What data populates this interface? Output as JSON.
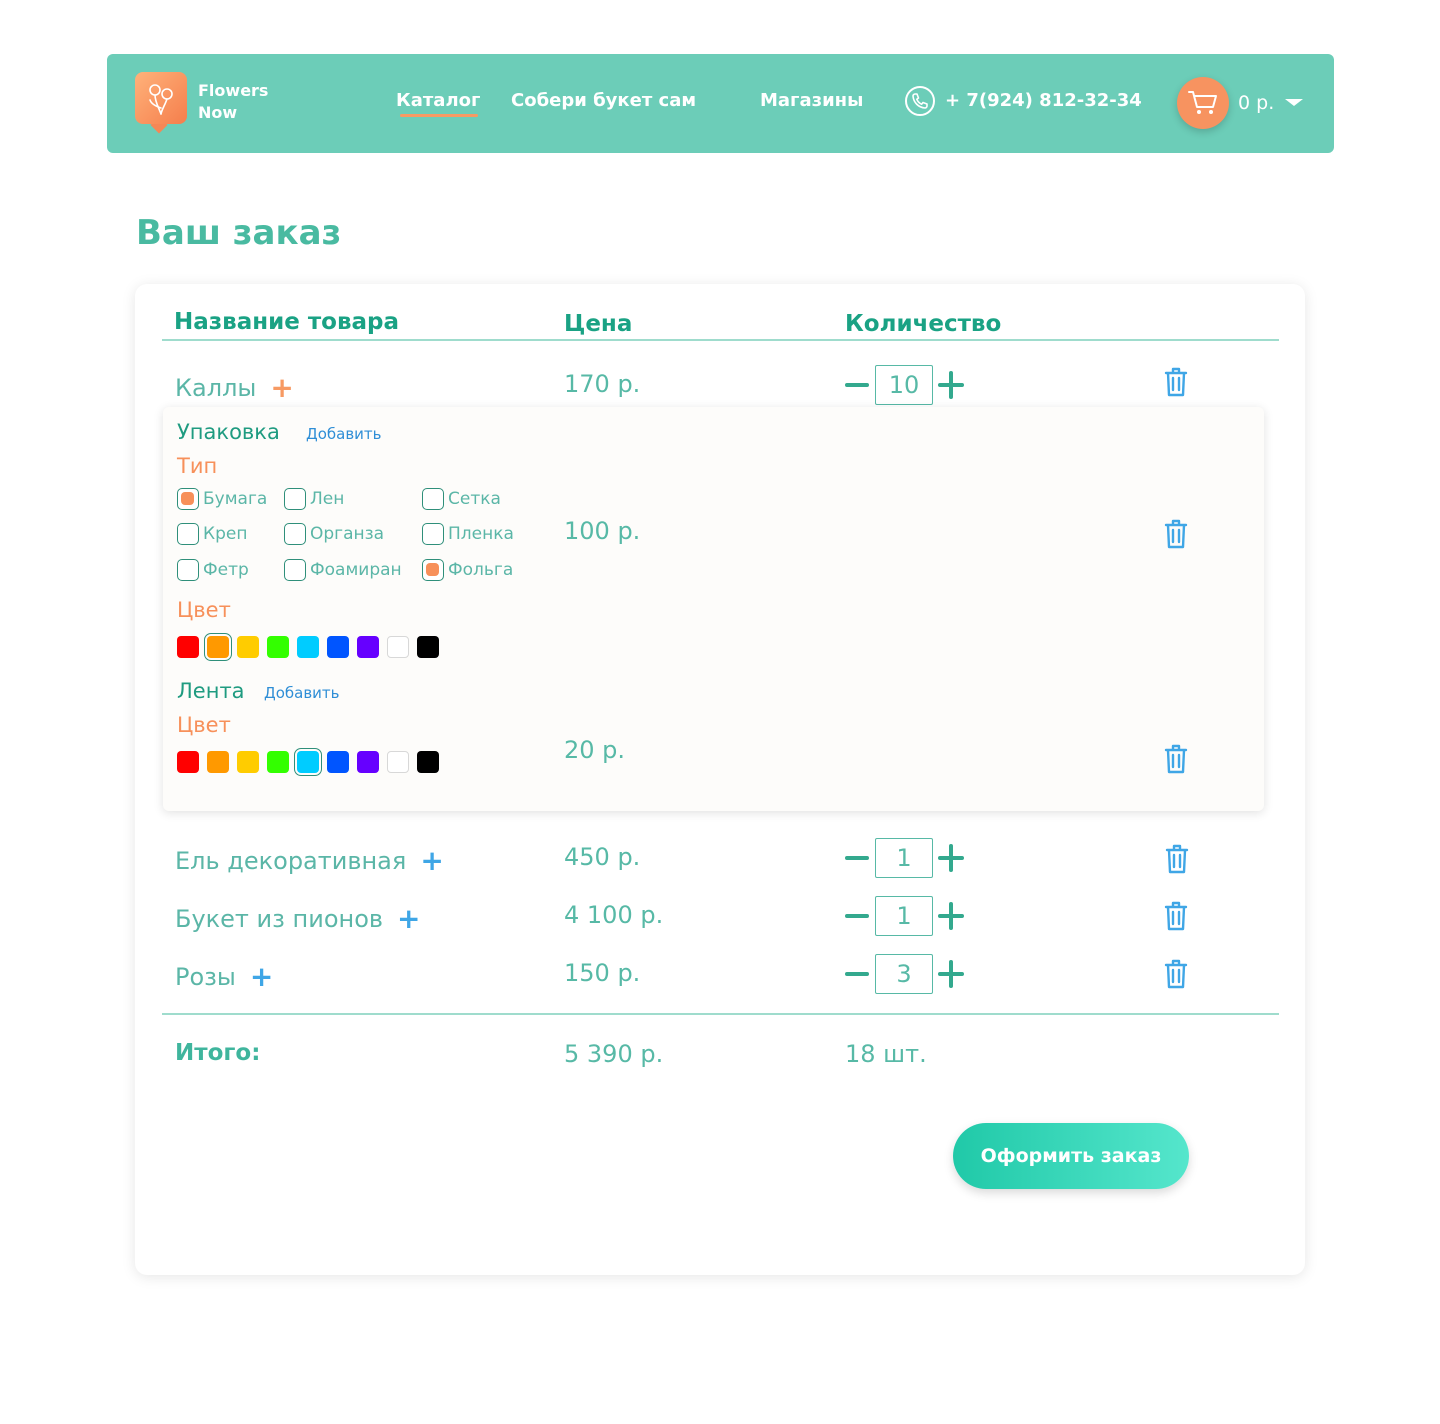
{
  "header": {
    "brand_line1": "Flowers",
    "brand_line2": "Now",
    "nav": [
      "Каталог",
      "Собери букет сам",
      "Магазины"
    ],
    "phone": "+ 7(924) 812-32-34",
    "cart_sum": "0 р.",
    "colors": {
      "bar": "#6ccdb8",
      "accent": "#f79360"
    }
  },
  "page_title": "Ваш заказ",
  "table": {
    "headers": {
      "name": "Название товара",
      "price": "Цена",
      "qty": "Количество"
    },
    "rows": [
      {
        "name": "Каллы",
        "price": "170 р.",
        "qty": "10"
      },
      {
        "name": "Ель декоративная",
        "price": "450 р.",
        "qty": "1"
      },
      {
        "name": "Букет из пионов",
        "price": "4 100 р.",
        "qty": "1"
      },
      {
        "name": "Розы",
        "price": "150 р.",
        "qty": "3"
      }
    ]
  },
  "options": {
    "packaging": {
      "title": "Упаковка",
      "add": "Добавить",
      "type_title": "Тип",
      "types": [
        {
          "label": "Бумага",
          "checked": true
        },
        {
          "label": "Лен",
          "checked": false
        },
        {
          "label": "Сетка",
          "checked": false
        },
        {
          "label": "Креп",
          "checked": false
        },
        {
          "label": "Органза",
          "checked": false
        },
        {
          "label": "Пленка",
          "checked": false
        },
        {
          "label": "Фетр",
          "checked": false
        },
        {
          "label": "Фоамиран",
          "checked": false
        },
        {
          "label": "Фольга",
          "checked": true
        }
      ],
      "color_title": "Цвет",
      "selected_color": "#ff9900",
      "price": "100 р."
    },
    "ribbon": {
      "title": "Лента",
      "add": "Добавить",
      "color_title": "Цвет",
      "selected_color": "#00ccff",
      "price": "20 р."
    },
    "palette": [
      "#ff0000",
      "#ff9900",
      "#ffcc00",
      "#33ff00",
      "#00ccff",
      "#0055ff",
      "#6600ff",
      "#ffffff",
      "#000000"
    ]
  },
  "totals": {
    "label": "Итого:",
    "price": "5 390 р.",
    "count": "18 шт."
  },
  "order_button": "Оформить заказ"
}
